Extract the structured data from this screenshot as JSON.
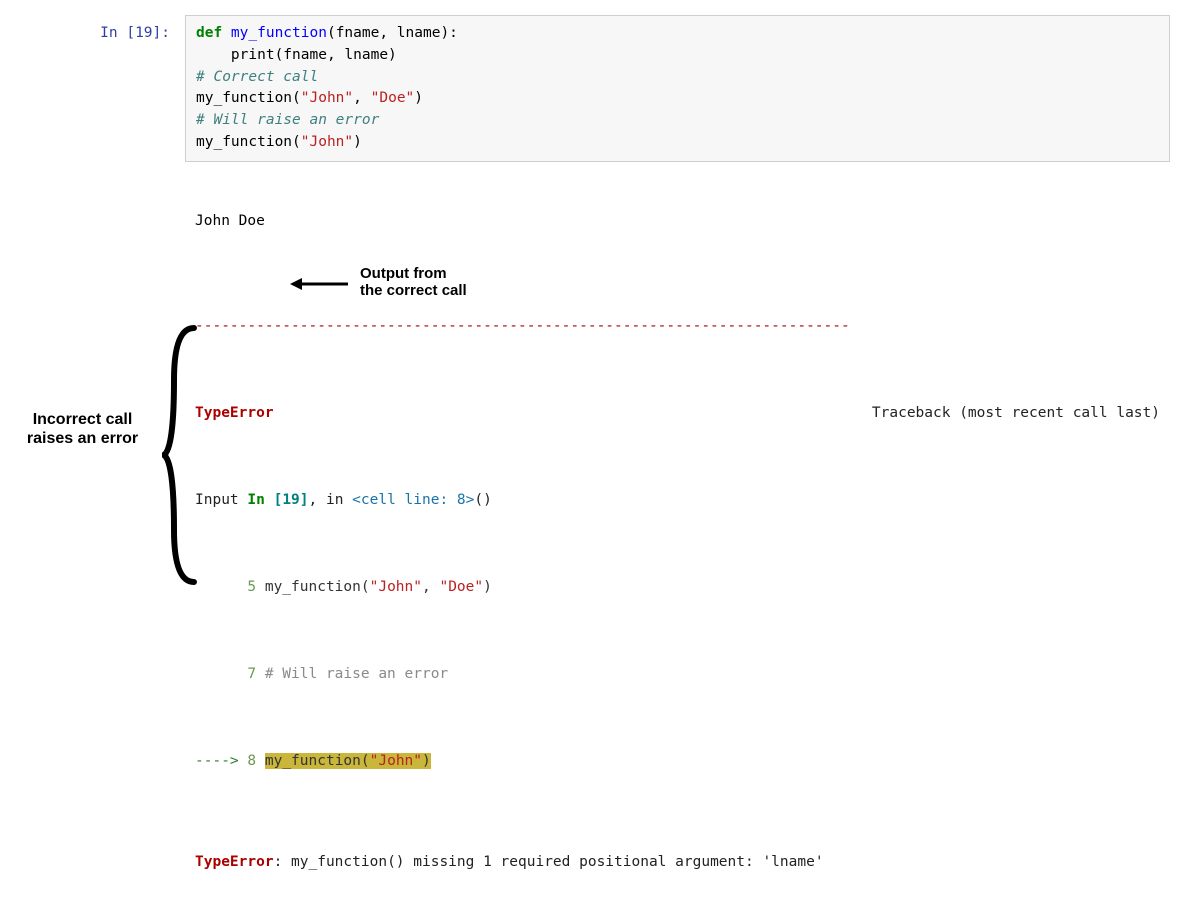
{
  "prompt": "In [19]:",
  "code": {
    "l1_def": "def",
    "l1_fn": " my_function",
    "l1_rest": "(fname, lname):",
    "l2": "    print(fname, lname)",
    "l3": "",
    "l4_cmt": "# Correct call",
    "l5_a": "my_function(",
    "l5_s1": "\"John\"",
    "l5_m": ", ",
    "l5_s2": "\"Doe\"",
    "l5_b": ")",
    "l6": "",
    "l7_cmt": "# Will raise an error",
    "l8_a": "my_function(",
    "l8_s1": "\"John\"",
    "l8_b": ")"
  },
  "output": {
    "stdout": "John Doe",
    "dashes": "---------------------------------------------------------------------------",
    "err_header_name": "TypeError",
    "err_header_right": "Traceback (most recent call last)",
    "tb_l1_a": "Input ",
    "tb_l1_in": "In ",
    "tb_l1_num": "[19]",
    "tb_l1_b": ", in ",
    "tb_l1_link": "<cell line: 8>",
    "tb_l1_c": "()",
    "tb_l2_ln": "      5",
    "tb_l2_code_a": " my_function(",
    "tb_l2_s1": "\"John\"",
    "tb_l2_m": ", ",
    "tb_l2_s2": "\"Doe\"",
    "tb_l2_b": ")",
    "tb_l3_ln": "      7",
    "tb_l3_code": " # Will raise an error",
    "tb_l4_arrow": "----> ",
    "tb_l4_ln": "8",
    "tb_l4_sp": " ",
    "tb_l4_code_a": "my_function(",
    "tb_l4_s1": "\"John\"",
    "tb_l4_b": ")",
    "err_final_name": "TypeError",
    "err_final_msg": ": my_function() missing 1 required positional argument: 'lname'"
  },
  "annotations": {
    "output_label_l1": "Output from",
    "output_label_l2": "the correct call",
    "incorrect_l1": "Incorrect call",
    "incorrect_l2": "raises an error"
  }
}
